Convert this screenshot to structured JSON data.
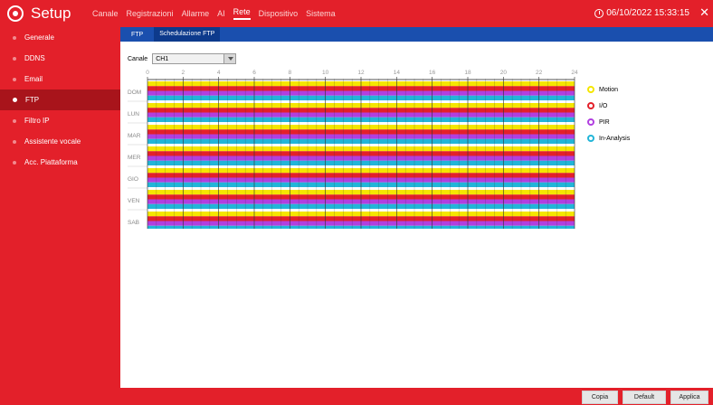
{
  "app": {
    "title": "Setup",
    "logo_icon": "gear-icon"
  },
  "topnav": [
    {
      "label": "Canale",
      "active": false
    },
    {
      "label": "Registrazioni",
      "active": false
    },
    {
      "label": "Allarme",
      "active": false
    },
    {
      "label": "AI",
      "active": false
    },
    {
      "label": "Rete",
      "active": true
    },
    {
      "label": "Dispositivo",
      "active": false
    },
    {
      "label": "Sistema",
      "active": false
    }
  ],
  "datetime": "06/10/2022 15:33:15",
  "sidebar": [
    {
      "label": "Generale",
      "active": false
    },
    {
      "label": "DDNS",
      "active": false
    },
    {
      "label": "Email",
      "active": false
    },
    {
      "label": "FTP",
      "active": true
    },
    {
      "label": "Filtro IP",
      "active": false
    },
    {
      "label": "Assistente vocale",
      "active": false
    },
    {
      "label": "Acc. Piattaforma",
      "active": false
    }
  ],
  "subtabs": [
    {
      "label": "FTP",
      "active": false
    },
    {
      "label": "Schedulazione FTP",
      "active": true
    }
  ],
  "canale": {
    "label": "Canale",
    "value": "CH1"
  },
  "schedule": {
    "hour_ticks": [
      "0",
      "2",
      "4",
      "6",
      "8",
      "10",
      "12",
      "14",
      "16",
      "18",
      "20",
      "22",
      "24"
    ],
    "days": [
      "DOM",
      "LUN",
      "MAR",
      "MER",
      "GIO",
      "VEN",
      "SAB"
    ]
  },
  "legend": [
    {
      "label": "Motion",
      "color": "#f5e600"
    },
    {
      "label": "I/O",
      "color": "#e3202a"
    },
    {
      "label": "PIR",
      "color": "#b13fe0"
    },
    {
      "label": "In-Analysis",
      "color": "#22b5d8"
    }
  ],
  "colors": {
    "brand_red": "#e3202a",
    "tab_blue": "#1a4fae"
  },
  "buttons": {
    "copy": "Copia",
    "default": "Default",
    "apply": "Applica"
  }
}
